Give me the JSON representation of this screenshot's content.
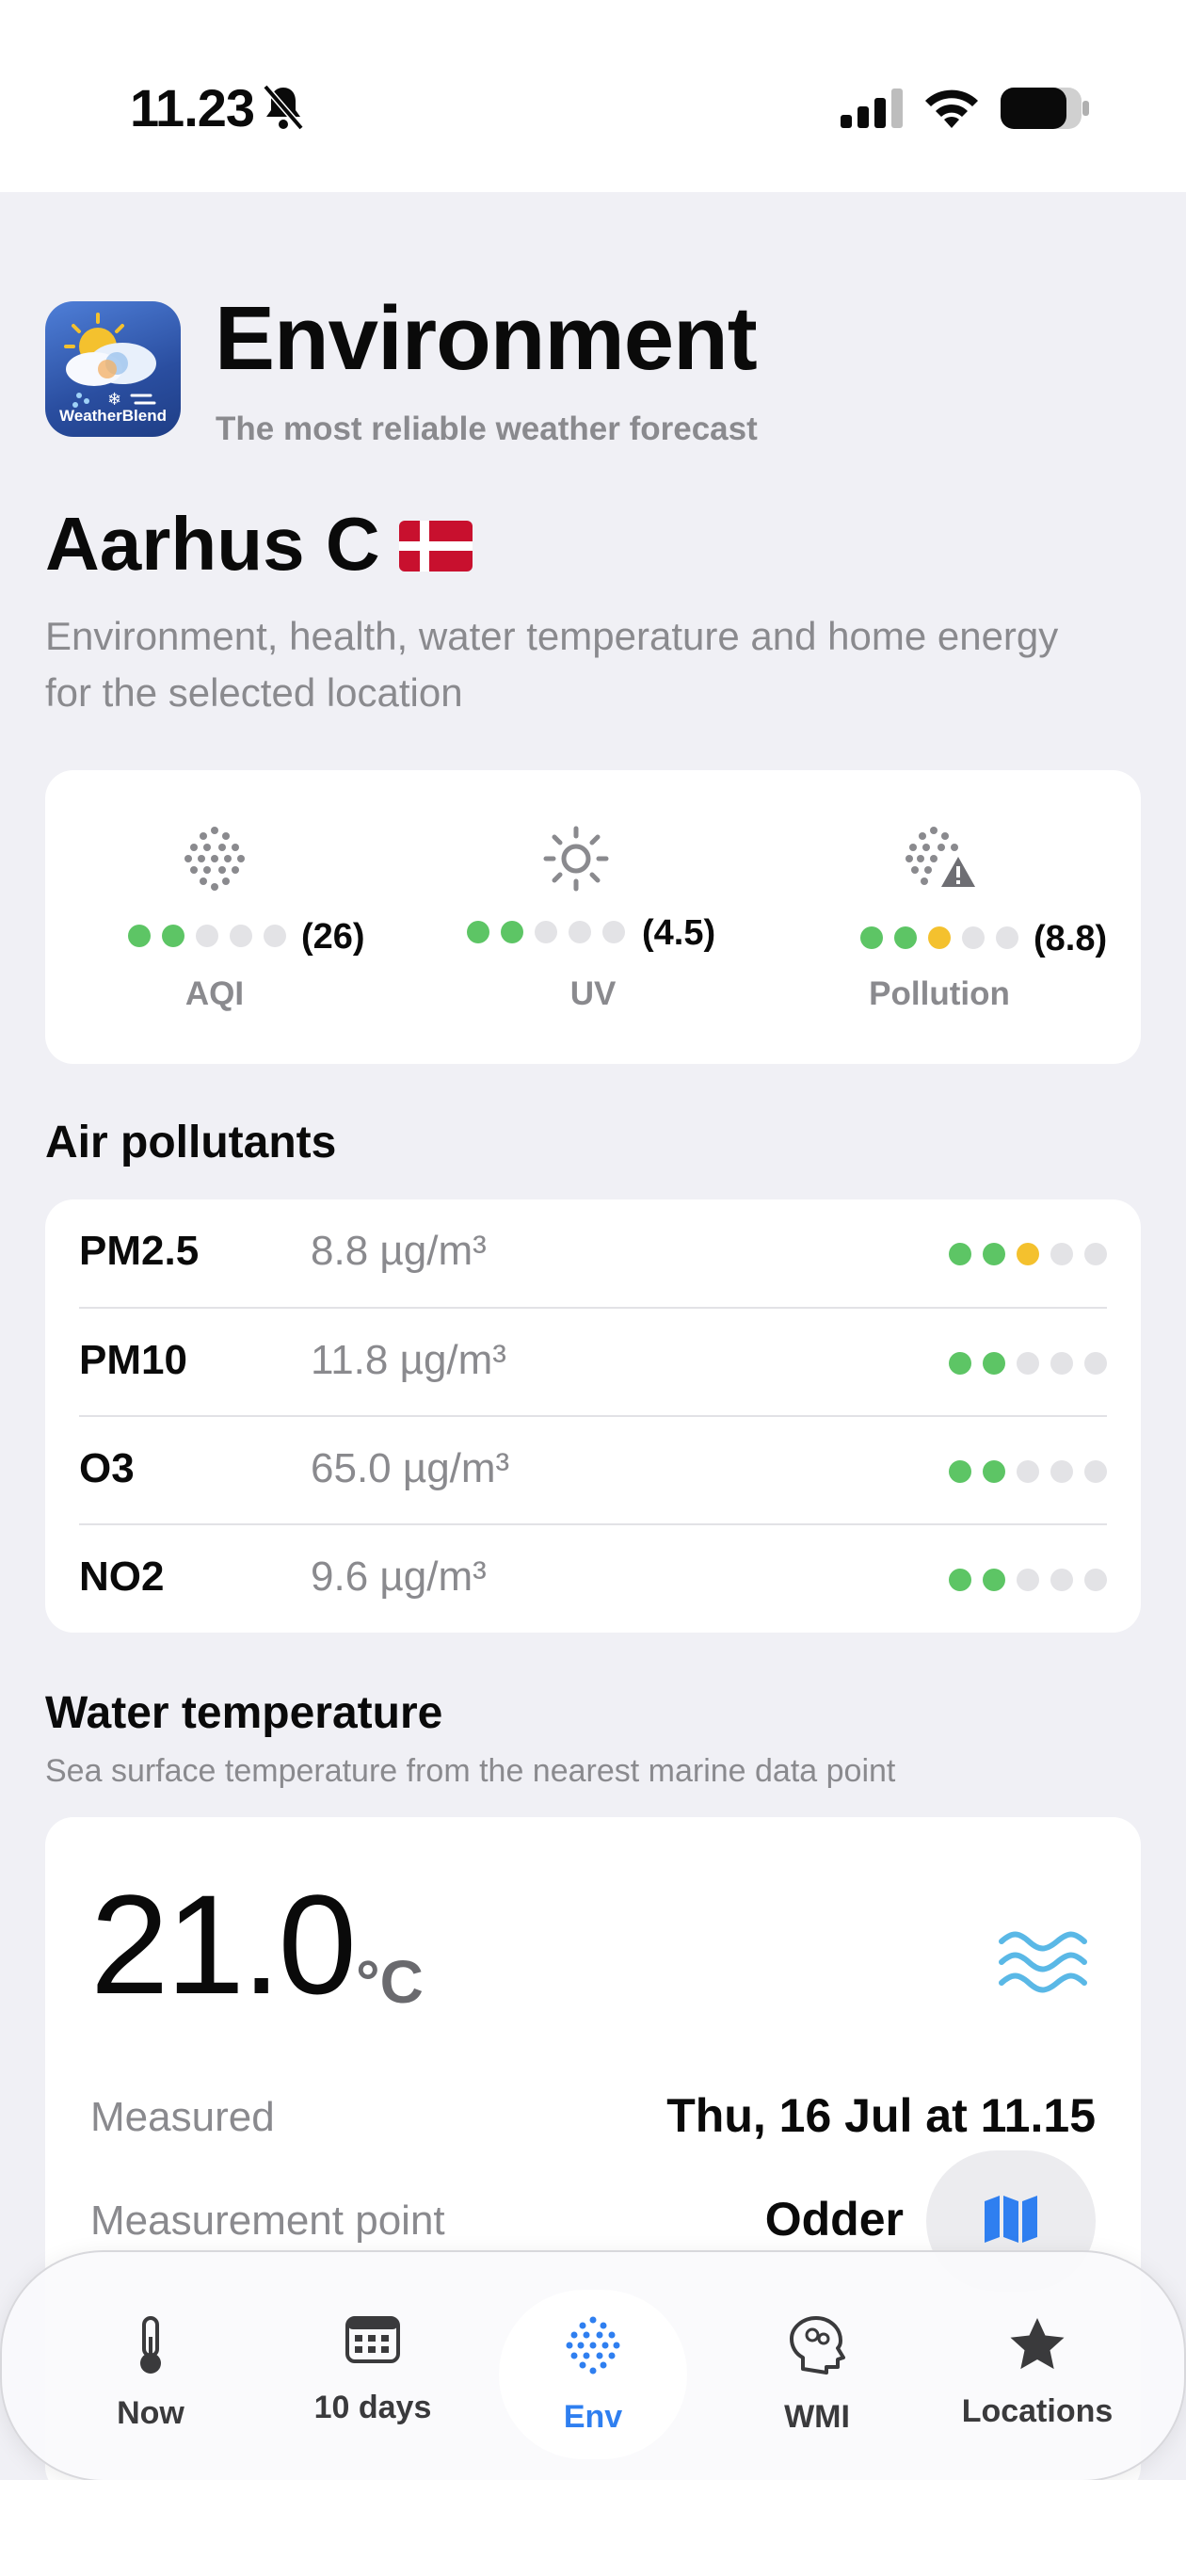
{
  "status_bar": {
    "time": "11.23"
  },
  "header": {
    "app_title": "Environment",
    "app_subtitle": "The most reliable weather forecast",
    "app_icon_text": "WeatherBlend"
  },
  "location": {
    "name": "Aarhus C",
    "description": "Environment, health, water temperature and home energy for the selected location"
  },
  "summary": {
    "aqi": {
      "label": "AQI",
      "value": "(26)",
      "level": 2
    },
    "uv": {
      "label": "UV",
      "value": "(4.5)",
      "level": 2
    },
    "pollution": {
      "label": "Pollution",
      "value": "(8.8)",
      "level": 3
    }
  },
  "air_pollutants": {
    "title": "Air pollutants",
    "rows": [
      {
        "name": "PM2.5",
        "value": "8.8 µg/m³",
        "level": 3
      },
      {
        "name": "PM10",
        "value": "11.8 µg/m³",
        "level": 2
      },
      {
        "name": "O3",
        "value": "65.0 µg/m³",
        "level": 2
      },
      {
        "name": "NO2",
        "value": "9.6 µg/m³",
        "level": 2
      }
    ]
  },
  "water": {
    "title": "Water temperature",
    "subtitle": "Sea surface temperature from the nearest marine data point",
    "temperature": "21.0",
    "unit": "°C",
    "measured_label": "Measured",
    "measured_value": "Thu, 16 Jul at 11.15",
    "point_label": "Measurement point",
    "point_value": "Odder"
  },
  "tabs": [
    {
      "label": "Now",
      "icon": "thermometer-icon"
    },
    {
      "label": "10 days",
      "icon": "calendar-icon"
    },
    {
      "label": "Env",
      "icon": "dots-grid-icon"
    },
    {
      "label": "WMI",
      "icon": "brain-head-icon"
    },
    {
      "label": "Locations",
      "icon": "star-icon"
    }
  ],
  "colors": {
    "good": "#5dc565",
    "moderate": "#f4c12e",
    "inactive": "#e3e3e6",
    "accent": "#2f7ff0",
    "water": "#5ab8e6"
  }
}
